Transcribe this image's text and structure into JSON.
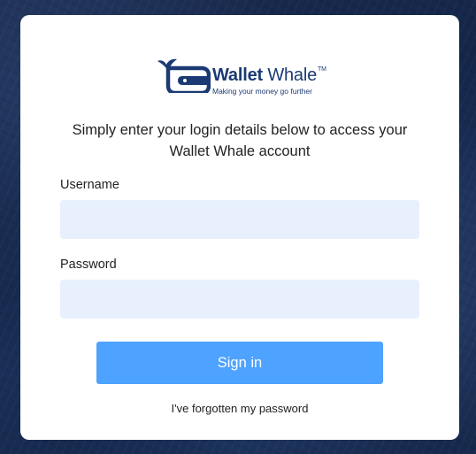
{
  "brand": {
    "name_bold": "Wallet",
    "name_regular": "Whale",
    "trademark": "TM",
    "tagline": "Making your money go further",
    "logo_icon": "whale-wallet-icon",
    "color": "#1b3a73"
  },
  "intro_text": "Simply enter your login details below to access your Wallet Whale account",
  "form": {
    "username_label": "Username",
    "username_value": "",
    "password_label": "Password",
    "password_value": "",
    "submit_label": "Sign in",
    "forgot_link": "I've forgotten my password"
  },
  "colors": {
    "primary_button": "#4da3ff",
    "input_background": "#e8f0fe",
    "background": "#14264a"
  }
}
